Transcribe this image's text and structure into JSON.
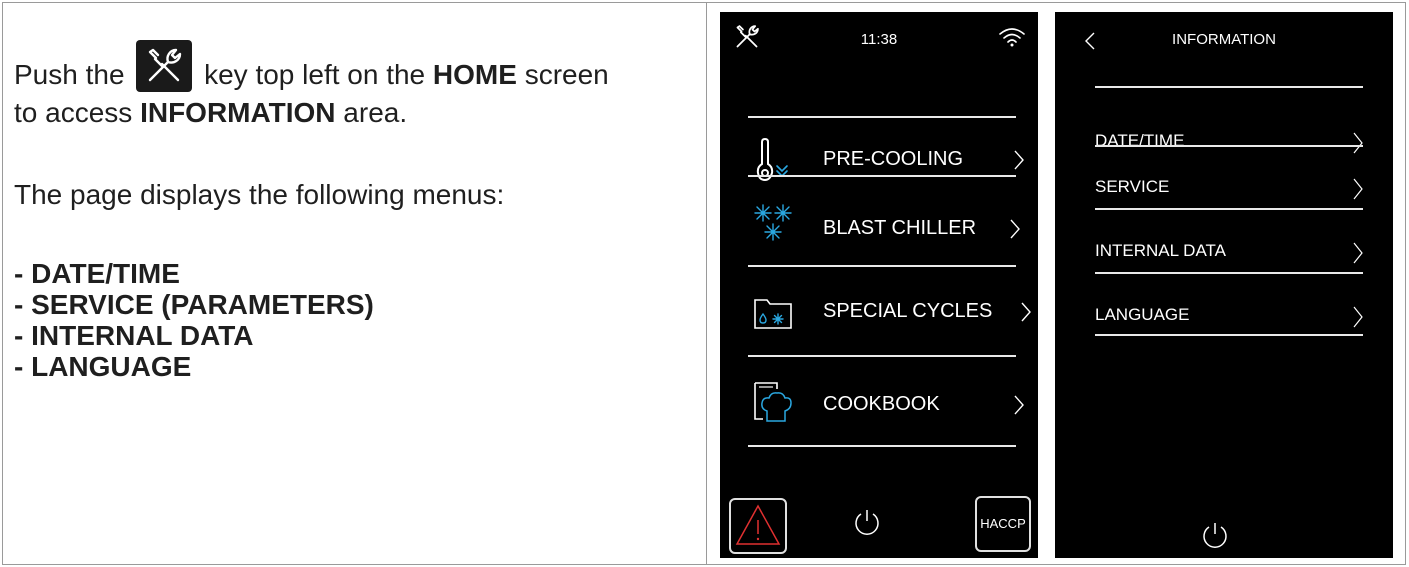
{
  "instructions": {
    "push_the": "Push the",
    "key_text": "key top left on the",
    "home": "HOME",
    "screen": "screen",
    "line2_prefix": "to access",
    "information": "INFORMATION",
    "line2_suffix": "area.",
    "page_displays": "The page displays the following menus:",
    "menu_list": [
      "- DATE/TIME",
      "- SERVICE (PARAMETERS)",
      "- INTERNAL DATA",
      "- LANGUAGE"
    ]
  },
  "home_screen": {
    "time": "11:38",
    "menu": [
      {
        "label": "PRE-COOLING",
        "icon": "thermometer-down-icon"
      },
      {
        "label": "BLAST CHILLER",
        "icon": "snowflakes-icon"
      },
      {
        "label": "SPECIAL CYCLES",
        "icon": "special-cycles-folder-icon"
      },
      {
        "label": "COOKBOOK",
        "icon": "chef-hat-book-icon"
      }
    ],
    "haccp_label": "HACCP"
  },
  "info_screen": {
    "title": "INFORMATION",
    "menu": [
      {
        "label": "DATE/TIME"
      },
      {
        "label": "SERVICE"
      },
      {
        "label": "INTERNAL DATA"
      },
      {
        "label": "LANGUAGE"
      }
    ]
  },
  "colors": {
    "screen_bg": "#000000",
    "accent_blue": "#2aa7e0",
    "alarm_red": "#e03030",
    "text_dark": "#1f1f1f"
  }
}
